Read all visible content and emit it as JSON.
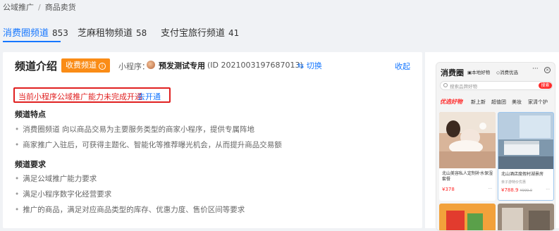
{
  "breadcrumb": {
    "parent": "公域推广",
    "current": "商品卖货"
  },
  "tabs": [
    {
      "label": "消费圈频道",
      "count": "853",
      "active": true
    },
    {
      "label": "芝麻租物频道",
      "count": "58",
      "active": false
    },
    {
      "label": "支付宝旅行频道",
      "count": "41",
      "active": false
    }
  ],
  "panel": {
    "title": "频道介绍",
    "badge": "收费频道",
    "mini_label": "小程序：",
    "mini_name": "预发测试专用",
    "mini_id": "(ID 2021003197687013)",
    "switch_label": "切换",
    "collapse_label": "收起",
    "alert_text": "当前小程序公域推广能力未完成开通",
    "alert_link": "去开通",
    "features_title": "频道特点",
    "features": [
      "消费圈频道 向以商品交易为主要服务类型的商家小程序，提供专属阵地",
      "商家推广入驻后，可获得主题化、智能化等推荐曝光机会，从而提升商品交易额"
    ],
    "requirements_title": "频道要求",
    "requirements": [
      "满足公域推广能力要求",
      "满足小程序数字化经营要求",
      "推广的商品，满足对应商品类型的库存、优惠力度、售价区间等要求"
    ]
  },
  "preview": {
    "app_title": "消费圈",
    "tag1": "本地好物",
    "tag2": "消费优选",
    "more": "···",
    "search_placeholder": "搜索品牌好物",
    "search_button": "搜索",
    "categories": [
      "优选好物",
      "新上新",
      "超值团",
      "美妆",
      "家清个护"
    ],
    "cards": [
      {
        "title": "北山美容私人定制补水保湿套餐",
        "sub": "",
        "price": "¥378",
        "orig": ""
      },
      {
        "title": "北山酒店度假村湖景房",
        "sub": "亲子游特价优惠",
        "price": "¥788.9",
        "orig": "¥999.0"
      }
    ]
  },
  "colors": {
    "accent": "#1677ff",
    "badge": "#fa8c16",
    "alert": "#e02020",
    "price": "#ff2a2a"
  }
}
